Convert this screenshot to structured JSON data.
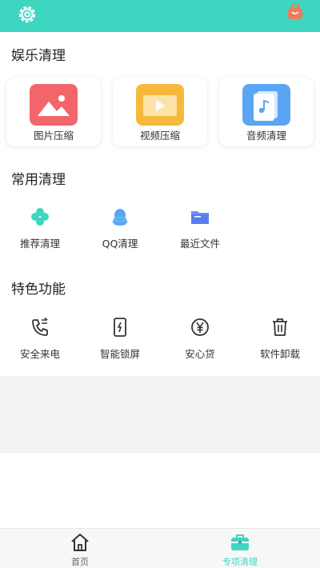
{
  "header": {
    "settings_icon": "gear-icon",
    "bag_icon": "shopping-bag-icon",
    "accent": "#3fd6c1"
  },
  "entertainment": {
    "title": "娱乐清理",
    "cards": [
      {
        "label": "图片压缩",
        "icon": "image-icon",
        "color": "#f2666b"
      },
      {
        "label": "视频压缩",
        "icon": "video-icon",
        "color": "#f6b93b"
      },
      {
        "label": "音频清理",
        "icon": "audio-icon",
        "color": "#5aa6f5"
      }
    ]
  },
  "common": {
    "title": "常用清理",
    "items": [
      {
        "label": "推荐清理",
        "icon": "clover-icon"
      },
      {
        "label": "QQ清理",
        "icon": "qq-icon"
      },
      {
        "label": "最近文件",
        "icon": "folder-icon"
      }
    ]
  },
  "features": {
    "title": "特色功能",
    "items": [
      {
        "label": "安全来电",
        "icon": "phone-icon"
      },
      {
        "label": "智能锁屏",
        "icon": "lock-screen-icon"
      },
      {
        "label": "安心贷",
        "icon": "yen-icon"
      },
      {
        "label": "软件卸载",
        "icon": "trash-icon"
      }
    ]
  },
  "tabbar": {
    "tabs": [
      {
        "label": "首页",
        "icon": "home-icon",
        "active": false
      },
      {
        "label": "专项清理",
        "icon": "briefcase-icon",
        "active": true
      }
    ]
  }
}
